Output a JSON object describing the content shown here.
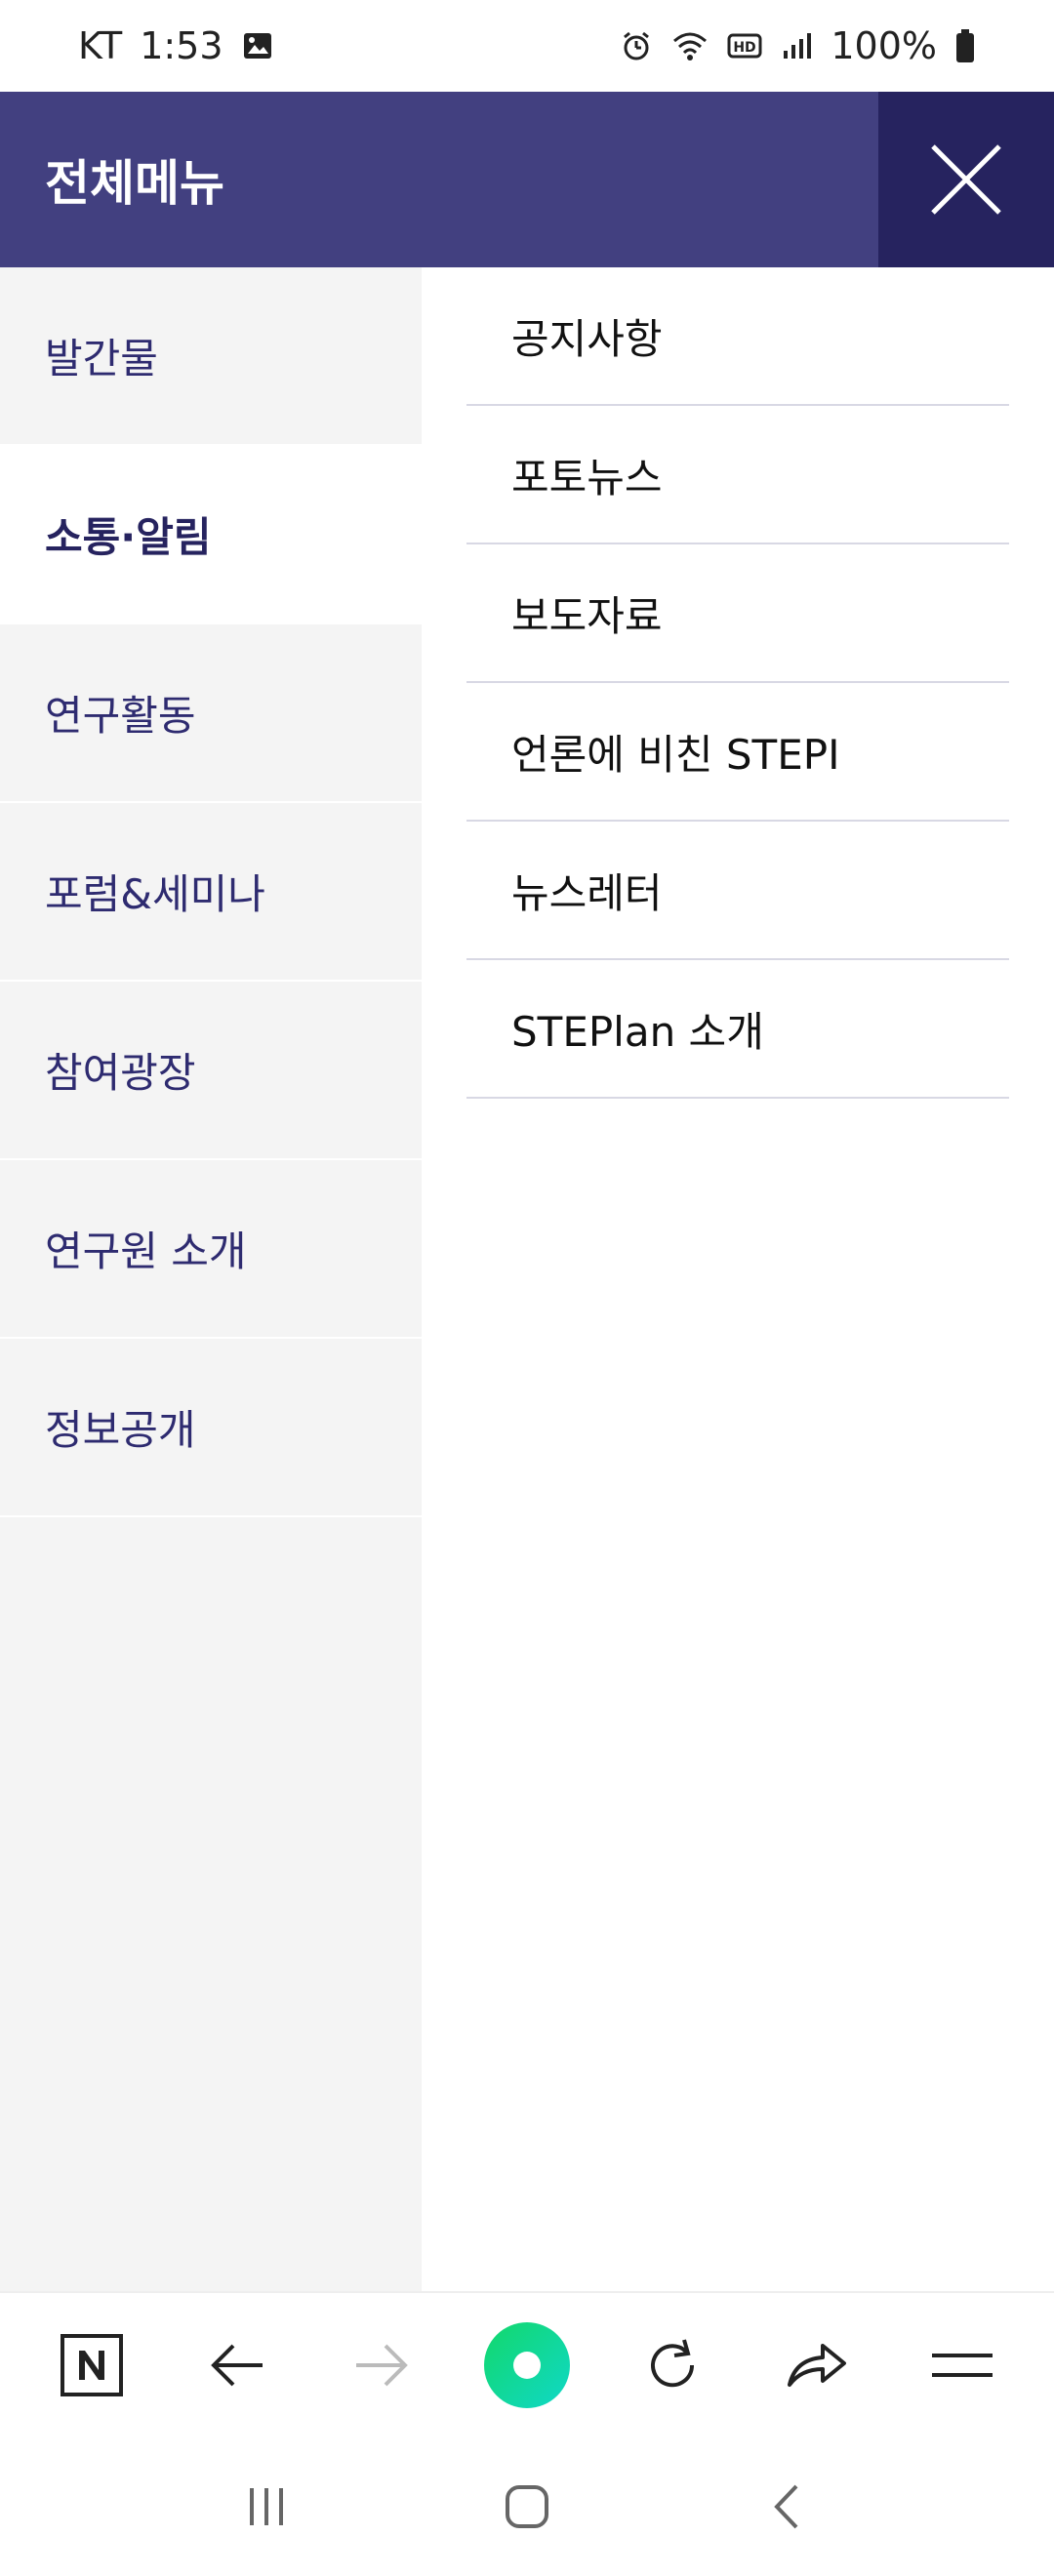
{
  "status_bar": {
    "carrier": "KT",
    "time": "1:53",
    "battery": "100%",
    "icons": [
      "gallery-icon",
      "alarm-icon",
      "wifi-icon",
      "hd-icon",
      "signal-icon",
      "battery-icon"
    ]
  },
  "header": {
    "title": "전체메뉴",
    "close_icon": "close-icon"
  },
  "left_menu": {
    "items": [
      {
        "label": "발간물",
        "active": false
      },
      {
        "label": "소통·알림",
        "active": true
      },
      {
        "label": "연구활동",
        "active": false
      },
      {
        "label": "포럼&세미나",
        "active": false
      },
      {
        "label": "참여광장",
        "active": false
      },
      {
        "label": "연구원 소개",
        "active": false
      },
      {
        "label": "정보공개",
        "active": false
      }
    ]
  },
  "right_menu": {
    "items": [
      {
        "label": "공지사항"
      },
      {
        "label": "포토뉴스"
      },
      {
        "label": "보도자료"
      },
      {
        "label": "언론에 비친 STEPI"
      },
      {
        "label": "뉴스레터"
      },
      {
        "label": "STEPlan 소개"
      }
    ]
  },
  "browser_toolbar": {
    "icons": [
      "naver-home-icon",
      "back-arrow-icon",
      "forward-arrow-icon",
      "green-dot-icon",
      "refresh-icon",
      "share-icon",
      "menu-icon"
    ]
  },
  "nav_bar": {
    "icons": [
      "recent-apps-icon",
      "home-icon",
      "back-icon"
    ]
  },
  "colors": {
    "header_bg": "#424080",
    "close_bg": "#26235f",
    "left_bg": "#f4f4f4",
    "left_text": "#2e2b70",
    "green": "#12d88a"
  }
}
